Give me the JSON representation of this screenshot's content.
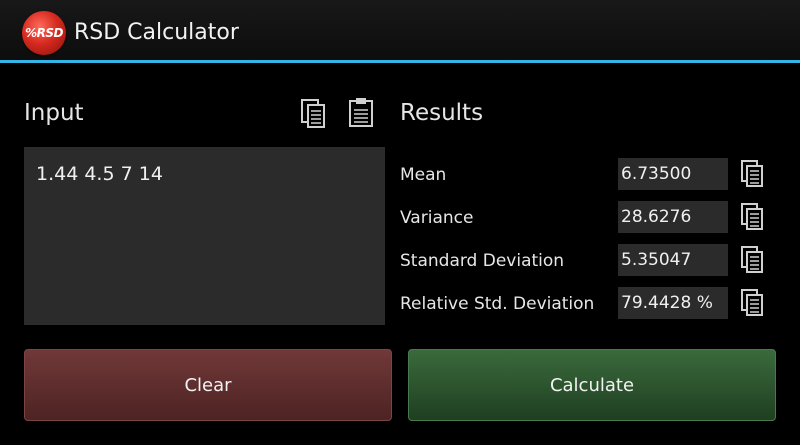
{
  "app": {
    "title": "RSD Calculator",
    "logo_text": "%RSD",
    "accent_color": "#33b5e5"
  },
  "input": {
    "heading": "Input",
    "value": "1.44 4.5 7 14",
    "copy_icon": "copy-icon",
    "paste_icon": "paste-icon"
  },
  "results": {
    "heading": "Results",
    "rows": [
      {
        "label": "Mean",
        "value": "6.73500"
      },
      {
        "label": "Variance",
        "value": "28.6276"
      },
      {
        "label": "Standard Deviation",
        "value": "5.35047"
      },
      {
        "label": "Relative Std. Deviation",
        "value": "79.4428 %"
      }
    ]
  },
  "buttons": {
    "clear": "Clear",
    "calculate": "Calculate",
    "clear_color": "#5e2d2d",
    "calculate_color": "#2d552f"
  }
}
